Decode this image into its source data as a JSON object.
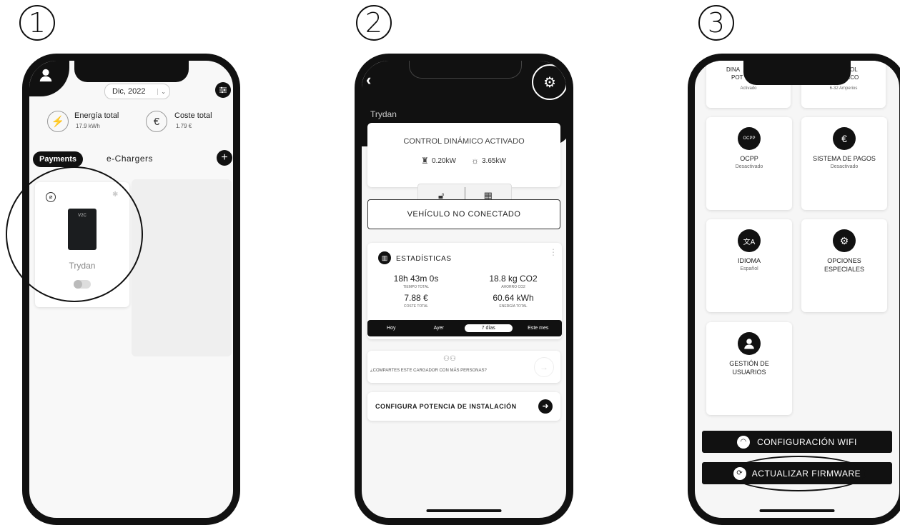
{
  "steps": [
    "1",
    "2",
    "3"
  ],
  "screen1": {
    "date_selector": "Dic, 2022",
    "energy_label": "Energía total",
    "energy_value": "17.9 kWh",
    "cost_label": "Coste total",
    "cost_value": "1.79 €",
    "tab_payments": "Payments",
    "tab_echargers": "e-Chargers",
    "charger_logo": "V2C",
    "charger_name": "Trydan"
  },
  "screen2": {
    "device_name": "Trydan",
    "control_status": "CONTROL DINÁMICO ACTIVADO",
    "grid_power": "0.20kW",
    "solar_power": "3.65kW",
    "vehicle_status": "VEHÍCULO NO CONECTADO",
    "stats_title": "ESTADÍSTICAS",
    "stats": [
      {
        "value": "18h 43m 0s",
        "label": "TIEMPO TOTAL"
      },
      {
        "value": "18.8 kg CO2",
        "label": "AHORRO CO2"
      },
      {
        "value": "7.88 €",
        "label": "COSTE TOTAL"
      },
      {
        "value": "60.64 kWh",
        "label": "ENERGÍA TOTAL"
      }
    ],
    "periods": [
      "Hoy",
      "Ayer",
      "7 días",
      "Este mes"
    ],
    "share_text": "¿COMPARTES ESTE CARGADOR CON MÁS PERSONAS?",
    "configure_text": "CONFIGURA POTENCIA DE INSTALACIÓN"
  },
  "screen3": {
    "top_left_title_a": "DINA",
    "top_left_title_b": "POT",
    "top_left_sub": "Activado",
    "top_right_title_a": "OL",
    "top_right_title_b": "ICO",
    "top_right_sub": "6-32 Amperios",
    "tiles": [
      {
        "title": "OCPP",
        "sub": "Desactivado",
        "icon": "ocpp-icon"
      },
      {
        "title": "SISTEMA DE PAGOS",
        "sub": "Desactivado",
        "icon": "euro-icon"
      },
      {
        "title": "IDIOMA",
        "sub": "Español",
        "icon": "translate-icon"
      },
      {
        "title": "OPCIONES ESPECIALES",
        "sub": "",
        "icon": "special-settings-icon"
      },
      {
        "title": "GESTIÓN DE USUARIOS",
        "sub": "",
        "icon": "user-icon"
      }
    ],
    "wifi_button": "CONFIGURACIÓN WIFI",
    "firmware_button": "ACTUALIZAR FIRMWARE"
  }
}
